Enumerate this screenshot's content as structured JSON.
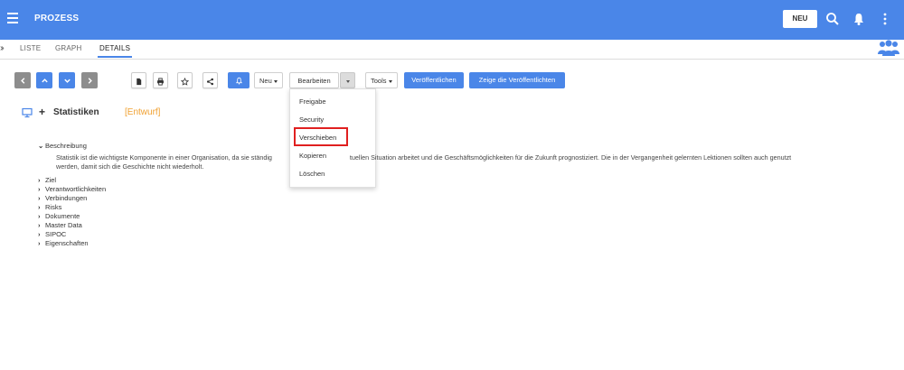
{
  "header": {
    "title": "PROZESS",
    "new_button": "NEU",
    "icons": [
      "hamburger-menu-icon",
      "search-icon",
      "bell-icon",
      "more-vertical-icon"
    ]
  },
  "tabs": [
    {
      "label": "LISTE",
      "active": false
    },
    {
      "label": "GRAPH",
      "active": false
    },
    {
      "label": "DETAILS",
      "active": true
    }
  ],
  "toolbar": {
    "new_label": "Neu",
    "edit_label": "Bearbeiten",
    "tools_label": "Tools",
    "publish_label": "Veröffentlichen",
    "show_published_label": "Zeige die Veröffentlichten"
  },
  "dropdown": {
    "items": [
      "Freigabe",
      "Security",
      "Verschieben",
      "Kopieren",
      "Löschen"
    ],
    "highlighted": "Verschieben"
  },
  "object": {
    "name": "Statistiken",
    "status": "[Entwurf]"
  },
  "sections": {
    "description_title": "Beschreibung",
    "description_text_1": "Statistik ist die wichtigste Komponente in einer Organisation, da sie ständig",
    "description_text_2": "tuellen Situation arbeitet und die Geschäftsmöglichkeiten für die Zukunft prognostiziert. Die in der Vergangenheit gelernten Lektionen sollten auch genutzt",
    "description_text_3": "werden, damit sich die Geschichte nicht wiederholt.",
    "collapsed": [
      "Ziel",
      "Verantwortlichkeiten",
      "Verbindungen",
      "Risks",
      "Dokumente",
      "Master Data",
      "SIPOC",
      "Eigenschaften"
    ]
  },
  "colors": {
    "primary": "#4a86e8",
    "draft": "#f0a030",
    "highlight_border": "#e02020"
  }
}
